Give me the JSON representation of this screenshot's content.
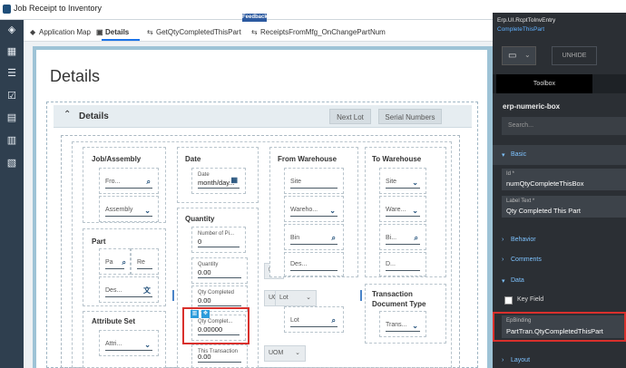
{
  "window": {
    "title": "Job Receipt to Inventory"
  },
  "tabs": [
    {
      "label": "Application Map"
    },
    {
      "label": "Details"
    },
    {
      "label": "GetQtyCompletedThisPart"
    },
    {
      "label": "ReceiptsFromMfg_OnChangePartNum"
    }
  ],
  "feedback_label": "Feedback",
  "page": {
    "title": "Details"
  },
  "panel": {
    "title": "Details",
    "next_lot": "Next Lot",
    "serial_numbers": "Serial Numbers"
  },
  "columns": {
    "job_assembly": {
      "title": "Job/Assembly",
      "job_placeholder": "Fro...",
      "assembly_placeholder": "Assembly"
    },
    "part": {
      "title": "Part",
      "part_placeholder": "Pa",
      "rev_placeholder": "Re",
      "desc_placeholder": "Des..."
    },
    "attribute_set": {
      "title": "Attribute Set",
      "attr_placeholder": "Attri..."
    },
    "date": {
      "title": "Date",
      "date_label": "Date",
      "date_value": "month/day..."
    },
    "quantity": {
      "title": "Quantity",
      "num_pieces_label": "Number of Pi...",
      "num_pieces_value": "0",
      "quantity_label": "Quantity",
      "quantity_value": "0.00",
      "qty_completed_label": "Qty Completed",
      "qty_completed_value": "0.00",
      "qty_completed_part_label": "Qty Complet...",
      "qty_completed_part_value": "0.00000",
      "this_transaction_label": "This Transaction",
      "this_transaction_value": "0.00",
      "uom1": "UOM",
      "uom2": "UOM",
      "uom3": "UOM"
    },
    "from_warehouse": {
      "title": "From Warehouse",
      "site": "Site",
      "warehouse": "Wareho...",
      "bin": "Bin",
      "desc": "Des...",
      "lot_label": "Lot",
      "lot_field": "Lot"
    },
    "to_warehouse": {
      "title": "To Warehouse",
      "site": "Site",
      "warehouse": "Ware...",
      "bin": "Bi...",
      "d": "D...",
      "tx_doc_type": "Transaction Document Type",
      "tx_placeholder": "Trans..."
    }
  },
  "right_panel": {
    "path_line1": "Erp.UI.RcptToInvEntry",
    "path_line2": "CompleteThisPart",
    "unhide": "UNHIDE",
    "toolbox": "Toolbox",
    "component_name": "erp-numeric-box",
    "search_placeholder": "Search...",
    "sections": {
      "basic": "Basic",
      "behavior": "Behavior",
      "comments": "Comments",
      "data": "Data",
      "layout": "Layout"
    },
    "fields": {
      "id_label": "Id *",
      "id_value": "numQtyCompleteThisBox",
      "label_text_label": "Label Text *",
      "label_text_value": "Qty Completed This Part",
      "key_field": "Key Field",
      "epbinding_label": "EpBinding",
      "epbinding_value": "PartTran.QtyCompletedThisPart"
    }
  },
  "colors": {
    "accent": "#1a73e8",
    "highlight": "#d9302c",
    "sidebar": "#2f3f4f",
    "panel": "#2b2f34"
  }
}
